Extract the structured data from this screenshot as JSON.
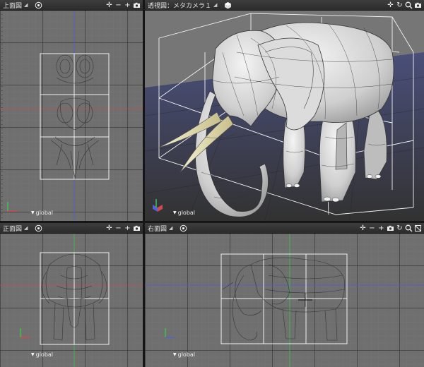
{
  "viewports": {
    "top": {
      "title": "上面図",
      "coord": "global"
    },
    "perspective": {
      "title": "透視図：メタカメラ１",
      "coord": "global"
    },
    "front": {
      "title": "正面図",
      "coord": "global"
    },
    "right": {
      "title": "右面図",
      "coord": "global"
    }
  },
  "toolbar_icons": [
    "move-icon",
    "zoom-out-icon",
    "zoom-in-icon",
    "rotate-icon",
    "camera-icon",
    "pan-icon",
    "undo-view-icon",
    "wireframe-icon"
  ],
  "colors": {
    "viewport_bg": "#6f6f6f",
    "axis_red": "#d24a4a",
    "axis_blue": "#5060d8",
    "axis_green": "#3fc24f",
    "frame": "#f2f2f2"
  }
}
